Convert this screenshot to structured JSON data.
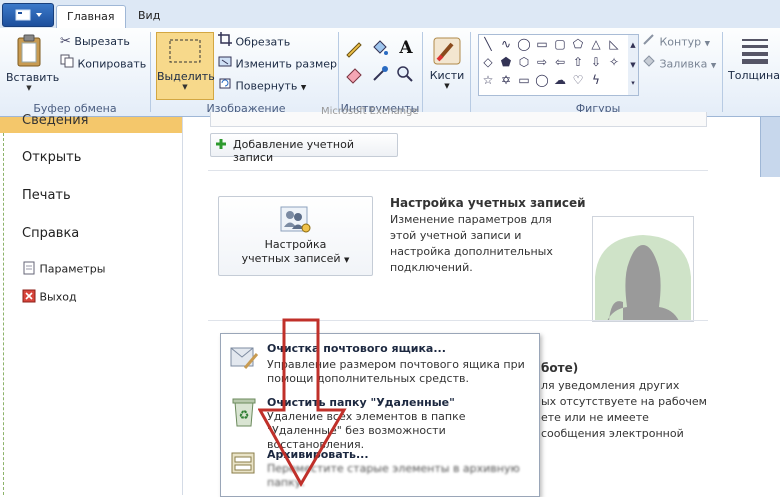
{
  "tabs": {
    "home": "Главная",
    "view": "Вид"
  },
  "clipboard": {
    "paste": "Вставить",
    "cut": "Вырезать",
    "copy": "Копировать",
    "group": "Буфер обмена"
  },
  "image": {
    "select": "Выделить",
    "crop": "Обрезать",
    "resize": "Изменить размер",
    "rotate": "Повернуть",
    "group": "Изображение"
  },
  "tools": {
    "group": "Инструменты"
  },
  "brushes": {
    "label": "Кисти"
  },
  "shapes": {
    "group": "Фигуры",
    "outline": "Контур",
    "fill": "Заливка"
  },
  "thickness": {
    "label": "Толщина"
  },
  "nav": {
    "info": "Сведения",
    "open": "Открыть",
    "print": "Печать",
    "help": "Справка",
    "options": "Параметры",
    "exit": "Выход"
  },
  "content": {
    "exchange_text": "Microsoft Exchange",
    "add_account": "Добавление учетной записи",
    "settings_button_line1": "Настройка",
    "settings_button_line2": "учетных записей",
    "settings_title": "Настройка учетных записей",
    "settings_desc": "Изменение параметров для этой учетной записи и настройка дополнительных подключений.",
    "behind_heading": "боте)",
    "behind_lines": [
      "ля уведомления других",
      "ых отсутствуете на рабочем",
      "ете или не имеете",
      "сообщения электронной"
    ]
  },
  "dropdown": {
    "items": [
      {
        "title": "Очистка почтового ящика...",
        "desc": "Управление размером почтового ящика при помощи дополнительных средств."
      },
      {
        "title": "Очистить папку \"Удаленные\"",
        "desc": "Удаление всех элементов в папке \"Удаленные\" без возможности восстановления."
      },
      {
        "title": "Архивировать...",
        "desc": "Переместите старые элементы в архивную папку."
      }
    ]
  },
  "colors": {
    "accent_red": "#c0302a",
    "nav_highlight": "#f4c76b",
    "ribbon_select": "#f7d98b"
  }
}
